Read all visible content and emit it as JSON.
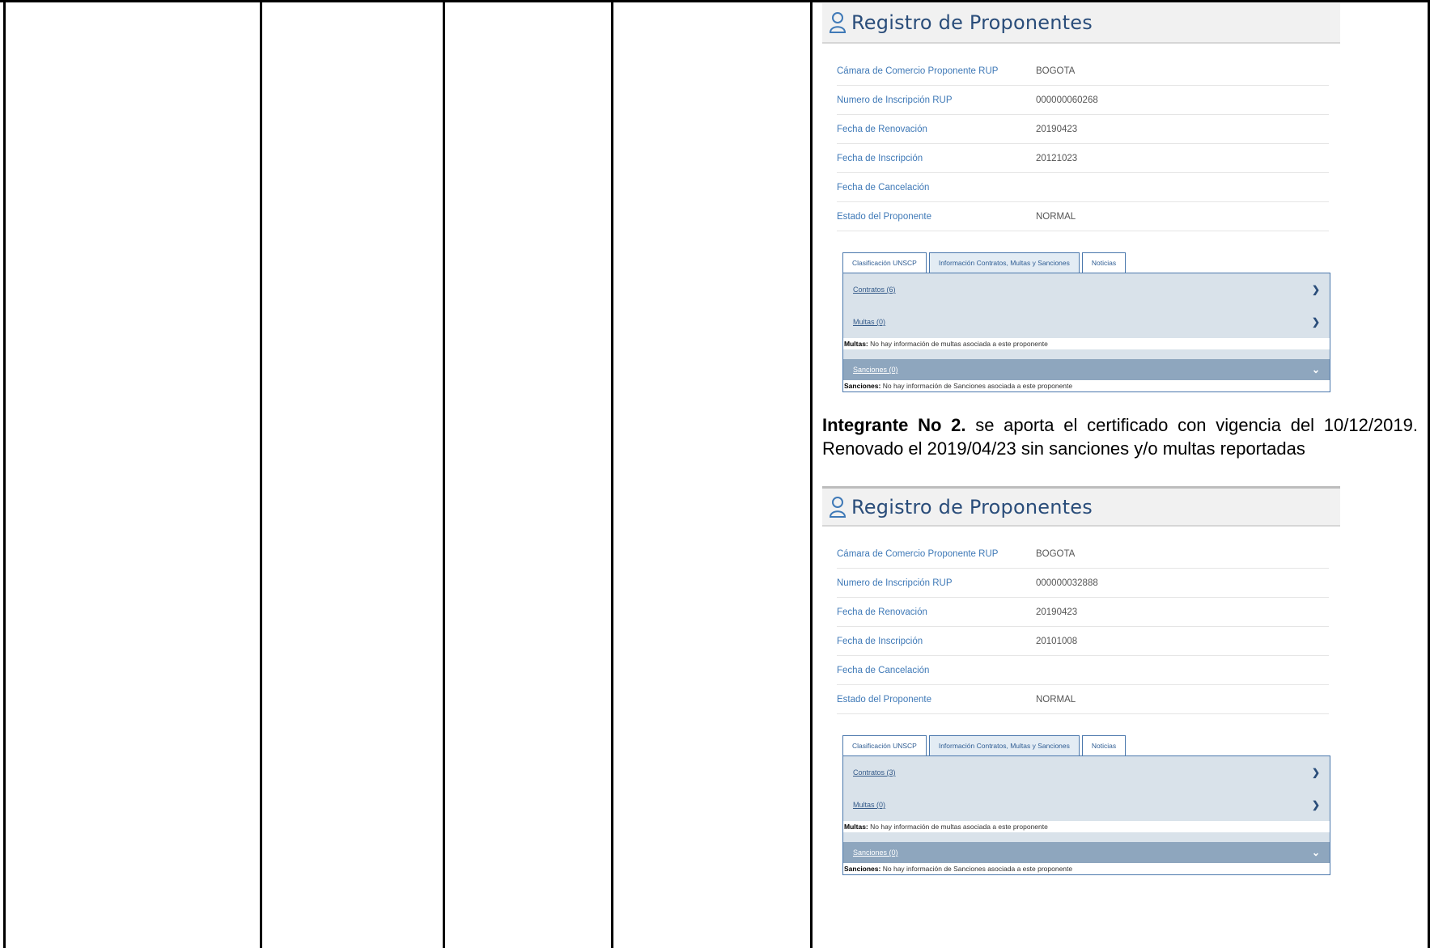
{
  "rup_blocks": [
    {
      "title": "Registro de Proponentes",
      "fields": [
        {
          "label": "Cámara de Comercio Proponente RUP",
          "value": "BOGOTA"
        },
        {
          "label": "Numero de Inscripción RUP",
          "value": "000000060268"
        },
        {
          "label": "Fecha de Renovación",
          "value": "20190423"
        },
        {
          "label": "Fecha de Inscripción",
          "value": "20121023"
        },
        {
          "label": "Fecha de Cancelación",
          "value": ""
        },
        {
          "label": "Estado del Proponente",
          "value": "NORMAL"
        }
      ],
      "tabs": [
        "Clasificación UNSCP",
        "Información Contratos, Multas y Sanciones",
        "Noticias"
      ],
      "contratos": "Contratos (6)",
      "multas": "Multas (0)",
      "multas_note_label": "Multas:",
      "multas_note": "No hay información de multas asociada a este proponente",
      "sanciones": "Sanciones (0)",
      "sanciones_note_label": "Sanciones:",
      "sanciones_note": "No hay información de Sanciones asociada a este proponente"
    },
    {
      "title": "Registro de Proponentes",
      "fields": [
        {
          "label": "Cámara de Comercio Proponente RUP",
          "value": "BOGOTA"
        },
        {
          "label": "Numero de Inscripción RUP",
          "value": "000000032888"
        },
        {
          "label": "Fecha de Renovación",
          "value": "20190423"
        },
        {
          "label": "Fecha de Inscripción",
          "value": "20101008"
        },
        {
          "label": "Fecha de Cancelación",
          "value": ""
        },
        {
          "label": "Estado del Proponente",
          "value": "NORMAL"
        }
      ],
      "tabs": [
        "Clasificación UNSCP",
        "Información Contratos, Multas y Sanciones",
        "Noticias"
      ],
      "contratos": "Contratos (3)",
      "multas": "Multas (0)",
      "multas_note_label": "Multas:",
      "multas_note": "No hay información de multas asociada a este proponente",
      "sanciones": "Sanciones (0)",
      "sanciones_note_label": "Sanciones:",
      "sanciones_note": "No hay información de Sanciones asociada a este proponente"
    }
  ],
  "integrante": {
    "bold": "Integrante No 2.",
    "text": " se aporta el certificado con vigencia del 10/12/2019. Renovado el 2019/04/23 sin sanciones y/o multas reportadas"
  },
  "colors": {
    "title": "#2a4d7a",
    "label": "#3f79b7",
    "dark_bar": "#8ea6be"
  }
}
